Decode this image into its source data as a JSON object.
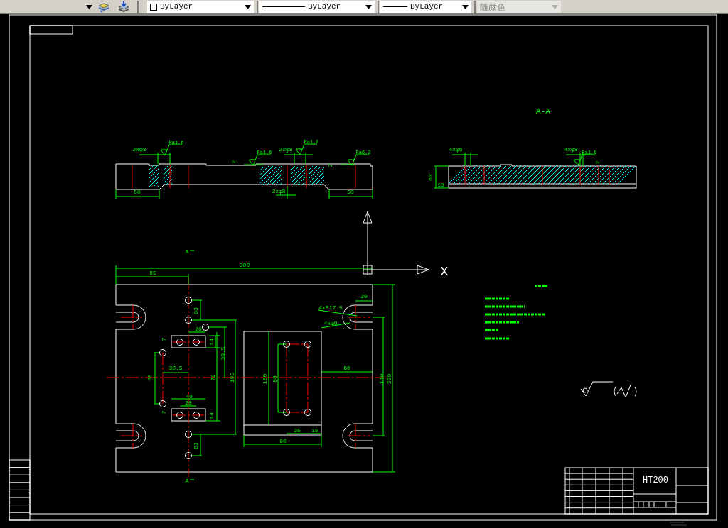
{
  "toolbar": {
    "color_control": "ByLayer",
    "linetype_control": "ByLayer",
    "lineweight_control": "ByLayer",
    "plot_style_control": "随颜色"
  },
  "drawing": {
    "section_label": "A-A",
    "material": "HT200",
    "axis_label": "X",
    "cut_marks": [
      "A",
      "A"
    ],
    "roughness_marks": [
      "Ra1.6",
      "Ra1.6",
      "Ra1.6",
      "Ra6.3",
      "Ra1.6"
    ],
    "section_dims": [
      "2xφ8",
      "50",
      "2",
      "2xφ8",
      "2",
      "2xφ8",
      "50",
      "4xφ6",
      "4xφ8",
      "63",
      "10",
      "2"
    ],
    "plan_dims": [
      "300",
      "85",
      "83",
      "20",
      "7",
      "14",
      "39.5",
      "30.5",
      "60",
      "72",
      "195",
      "40",
      "20",
      "7",
      "14",
      "83",
      "100",
      "80",
      "60",
      "25",
      "15",
      "90",
      "140",
      "220",
      "20",
      "4xR17.5",
      "4xφ9"
    ]
  }
}
